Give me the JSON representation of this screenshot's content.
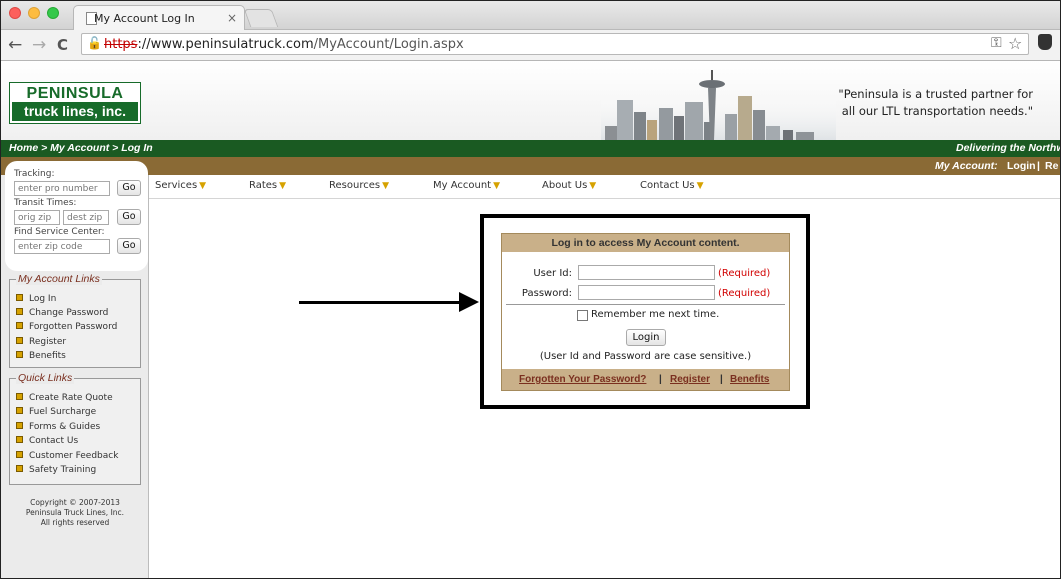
{
  "browser": {
    "tab_title": "My Account Log In",
    "tab_close": "×",
    "url_scheme": "https",
    "url_host": "://www.peninsulatruck.com",
    "url_path": "/MyAccount/Login.aspx",
    "back": "←",
    "forward": "→",
    "reload": "C",
    "ssl_icon": "🔓",
    "key_icon": "⚿",
    "star_icon": "☆"
  },
  "header": {
    "logo_top": "PENINSULA",
    "logo_bottom": "truck lines, inc.",
    "quote_line1": "\"Peninsula is a trusted partner for",
    "quote_line2": "all our LTL transportation needs.\""
  },
  "greenbar": {
    "breadcrumb": "Home > My Account > Log In",
    "tagline": "Delivering the Northw"
  },
  "brownbar": {
    "account_label": "My Account:",
    "login": "Login",
    "sep": "|",
    "register": "Re"
  },
  "tools": {
    "tracking_label": "Tracking:",
    "tracking_placeholder": "enter pro number",
    "transit_label": "Transit Times:",
    "orig_placeholder": "orig zip",
    "dest_placeholder": "dest zip",
    "service_label": "Find Service Center:",
    "zip_placeholder": "enter zip code",
    "go": "Go"
  },
  "account_links": {
    "title": "My Account Links",
    "items": [
      "Log In",
      "Change Password",
      "Forgotten Password",
      "Register",
      "Benefits"
    ]
  },
  "quick_links": {
    "title": "Quick Links",
    "items": [
      "Create Rate Quote",
      "Fuel Surcharge",
      "Forms & Guides",
      "Contact Us",
      "Customer Feedback",
      "Safety Training"
    ]
  },
  "copyright": {
    "line1": "Copyright © 2007-2013",
    "line2": "Peninsula Truck Lines, Inc.",
    "line3": "All rights reserved"
  },
  "nav": {
    "items": [
      "Services",
      "Rates",
      "Resources",
      "My Account",
      "About Us",
      "Contact Us"
    ],
    "triangle": "▼"
  },
  "login": {
    "heading": "Log in to access My Account content.",
    "user_label": "User Id:",
    "password_label": "Password:",
    "required": "(Required)",
    "remember": "Remember me next time.",
    "button": "Login",
    "note": "(User Id and Password are case sensitive.)",
    "forgot": "Forgotten Your Password?",
    "register": "Register",
    "benefits": "Benefits",
    "sep": "|"
  },
  "colors": {
    "green": "#1a5a22",
    "brown": "#8a6a35",
    "panel_tan": "#c9b089",
    "required_red": "#d10000",
    "link_maroon": "#7a2f1f"
  }
}
